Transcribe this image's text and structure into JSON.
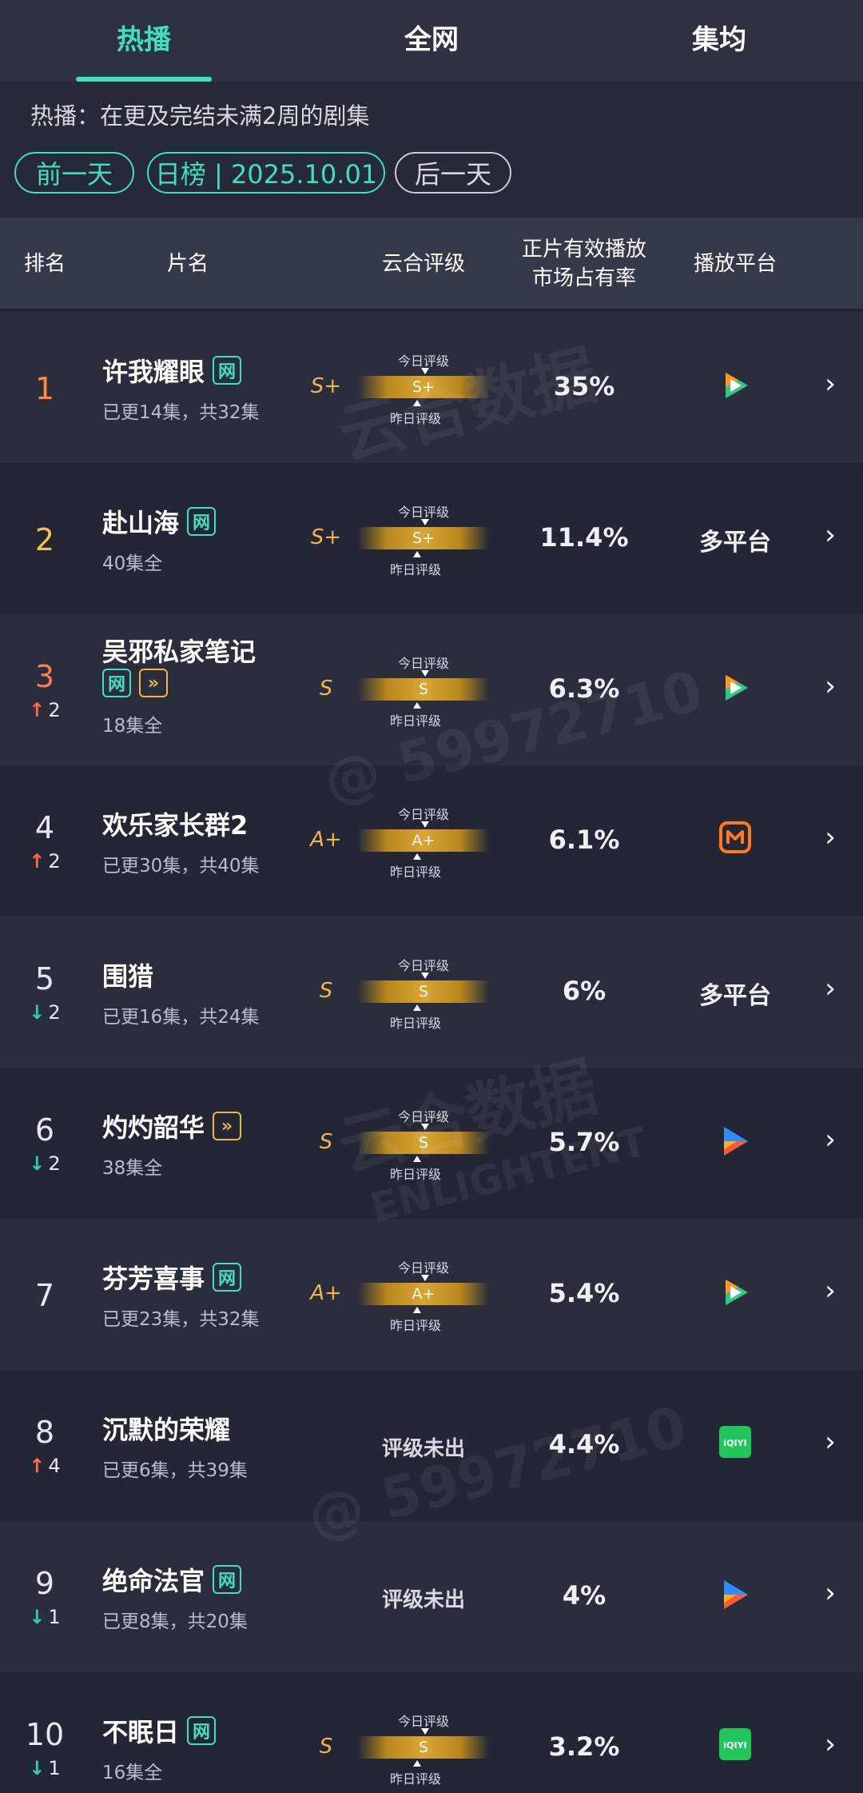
{
  "tabs": [
    {
      "label": "热播",
      "active": true
    },
    {
      "label": "全网",
      "active": false
    },
    {
      "label": "集均",
      "active": false
    }
  ],
  "note": "热播：在更及完结未满2周的剧集",
  "nav": {
    "prev": "前一天",
    "current": "日榜 | 2025.10.01",
    "next": "后一天"
  },
  "headers": {
    "rank": "排名",
    "title": "片名",
    "grade": "云合评级",
    "share_line1": "正片有效播放",
    "share_line2": "市场占有率",
    "platform": "播放平台"
  },
  "grade_labels": {
    "today": "今日评级",
    "yesterday": "昨日评级",
    "none": "评级未出"
  },
  "watermarks": [
    "云合数据",
    "ENLIGHTENT",
    "@  59972710"
  ],
  "rows": [
    {
      "rank": "1",
      "change": "",
      "dir": "",
      "title": "许我耀眼",
      "badges": [
        "net"
      ],
      "eps": "已更14集，共32集",
      "grade": "S+",
      "bar_grade": "S+",
      "share": "35%",
      "platform_icon": "tencent-video-icon",
      "platform_text": ""
    },
    {
      "rank": "2",
      "change": "",
      "dir": "",
      "title": "赴山海",
      "badges": [
        "net"
      ],
      "eps": "40集全",
      "grade": "S+",
      "bar_grade": "S+",
      "share": "11.4%",
      "platform_icon": "",
      "platform_text": "多平台"
    },
    {
      "rank": "3",
      "change": "2",
      "dir": "up",
      "title": "吴邪私家笔记",
      "badges": [
        "net",
        "ff"
      ],
      "eps": "18集全",
      "grade": "S",
      "bar_grade": "S",
      "share": "6.3%",
      "platform_icon": "tencent-video-icon",
      "platform_text": ""
    },
    {
      "rank": "4",
      "change": "2",
      "dir": "up",
      "title": "欢乐家长群2",
      "badges": [],
      "eps": "已更30集，共40集",
      "grade": "A+",
      "bar_grade": "A+",
      "share": "6.1%",
      "platform_icon": "mango-tv-icon",
      "platform_text": ""
    },
    {
      "rank": "5",
      "change": "2",
      "dir": "down",
      "title": "围猎",
      "badges": [],
      "eps": "已更16集，共24集",
      "grade": "S",
      "bar_grade": "S",
      "share": "6%",
      "platform_icon": "",
      "platform_text": "多平台"
    },
    {
      "rank": "6",
      "change": "2",
      "dir": "down",
      "title": "灼灼韶华",
      "badges": [
        "ff"
      ],
      "eps": "38集全",
      "grade": "S",
      "bar_grade": "S",
      "share": "5.7%",
      "platform_icon": "youku-icon",
      "platform_text": ""
    },
    {
      "rank": "7",
      "change": "",
      "dir": "",
      "title": "芬芳喜事",
      "badges": [
        "net"
      ],
      "eps": "已更23集，共32集",
      "grade": "A+",
      "bar_grade": "A+",
      "share": "5.4%",
      "platform_icon": "tencent-video-icon",
      "platform_text": ""
    },
    {
      "rank": "8",
      "change": "4",
      "dir": "up",
      "title": "沉默的荣耀",
      "badges": [],
      "eps": "已更6集，共39集",
      "grade": "",
      "bar_grade": "",
      "share": "4.4%",
      "platform_icon": "iqiyi-icon",
      "platform_text": ""
    },
    {
      "rank": "9",
      "change": "1",
      "dir": "down",
      "title": "绝命法官",
      "badges": [
        "net"
      ],
      "eps": "已更8集，共20集",
      "grade": "",
      "bar_grade": "",
      "share": "4%",
      "platform_icon": "youku-icon",
      "platform_text": ""
    },
    {
      "rank": "10",
      "change": "1",
      "dir": "down",
      "title": "不眠日",
      "badges": [
        "net"
      ],
      "eps": "16集全",
      "grade": "S",
      "bar_grade": "S",
      "share": "3.2%",
      "platform_icon": "iqiyi-icon",
      "platform_text": ""
    }
  ],
  "badge_text": {
    "net": "网",
    "ff": "»"
  },
  "colors": {
    "accent": "#3ee0c0",
    "gold": "#f0b44a",
    "up": "#ff6a45",
    "down": "#2ed0a6"
  }
}
